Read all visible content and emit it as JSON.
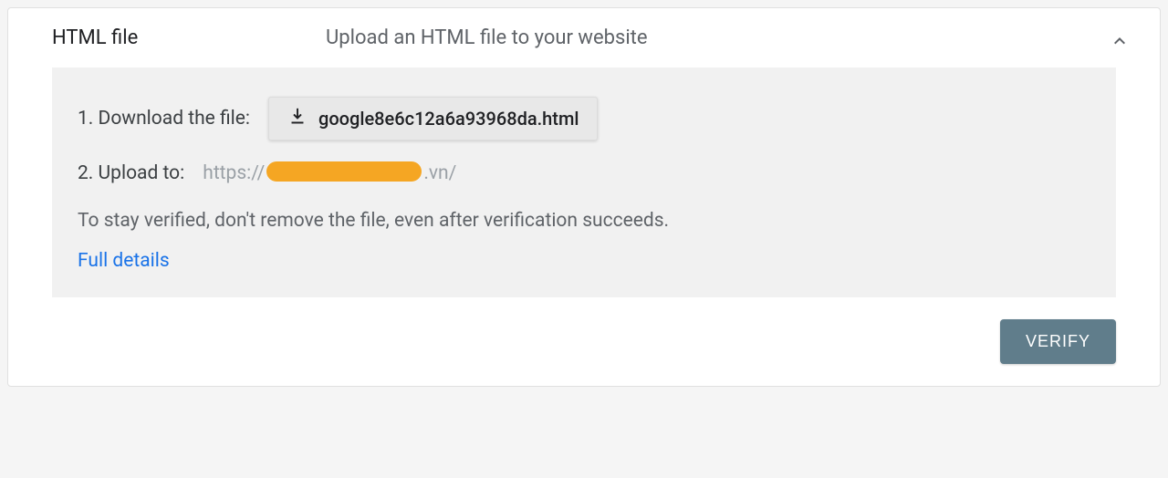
{
  "panel": {
    "title": "HTML file",
    "subtitle": "Upload an HTML file to your website"
  },
  "step1": {
    "label": "1. Download the file:",
    "filename": "google8e6c12a6a93968da.html"
  },
  "step2": {
    "label": "2. Upload to: ",
    "url_prefix": "https://",
    "url_suffix": ".vn/"
  },
  "hint": "To stay verified, don't remove the file, even after verification succeeds.",
  "link": "Full details",
  "verify": "VERIFY"
}
